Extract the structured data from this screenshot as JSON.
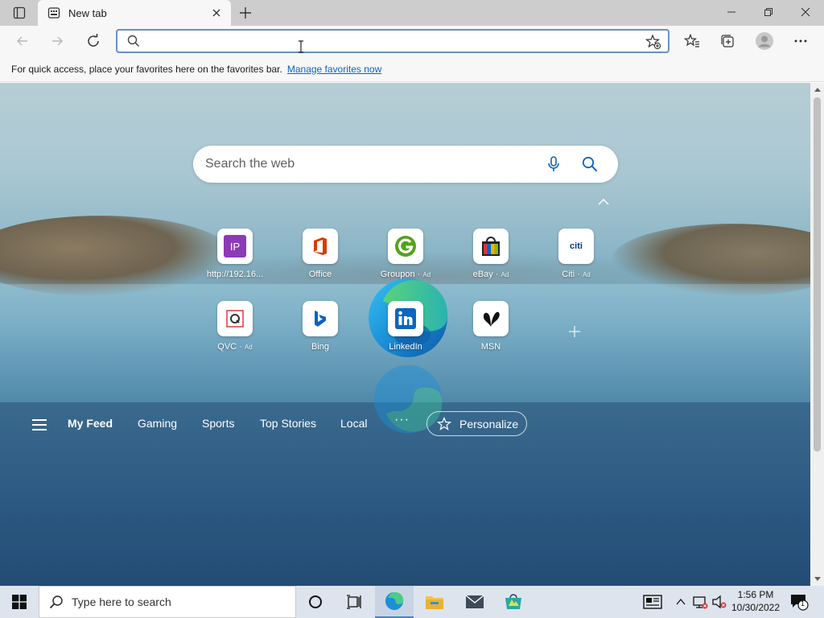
{
  "browser": {
    "tab": {
      "title": "New tab"
    },
    "address_bar": {
      "value": "",
      "placeholder": ""
    },
    "favorites_bar": {
      "message": "For quick access, place your favorites here on the favorites bar.",
      "link_label": "Manage favorites now"
    }
  },
  "new_tab_page": {
    "search": {
      "placeholder": "Search the web"
    },
    "quick_links": [
      {
        "label": "http://192.16...",
        "ad": "",
        "icon": "ip-icon"
      },
      {
        "label": "Office",
        "ad": "",
        "icon": "office-icon"
      },
      {
        "label": "Groupon",
        "ad": "Ad",
        "icon": "groupon-icon"
      },
      {
        "label": "eBay",
        "ad": "Ad",
        "icon": "ebay-icon"
      },
      {
        "label": "Citi",
        "ad": "Ad",
        "icon": "citi-icon"
      },
      {
        "label": "QVC",
        "ad": "Ad",
        "icon": "qvc-icon"
      },
      {
        "label": "Bing",
        "ad": "",
        "icon": "bing-icon"
      },
      {
        "label": "LinkedIn",
        "ad": "",
        "icon": "linkedin-icon"
      },
      {
        "label": "MSN",
        "ad": "",
        "icon": "msn-icon"
      }
    ],
    "icon_text": {
      "ip": "IP",
      "citi": "citi"
    },
    "feed_tabs": [
      "My Feed",
      "Gaming",
      "Sports",
      "Top Stories",
      "Local"
    ],
    "more_label": "···",
    "personalize_label": "Personalize"
  },
  "taskbar": {
    "search_placeholder": "Type here to search",
    "clock": {
      "time": "1:56 PM",
      "date": "10/30/2022"
    },
    "notification_count": "1"
  },
  "colors": {
    "accent": "#0b63c5",
    "linkedin": "#0a66c2",
    "office": "#d83b01",
    "taskbar": "#dde4ee"
  }
}
